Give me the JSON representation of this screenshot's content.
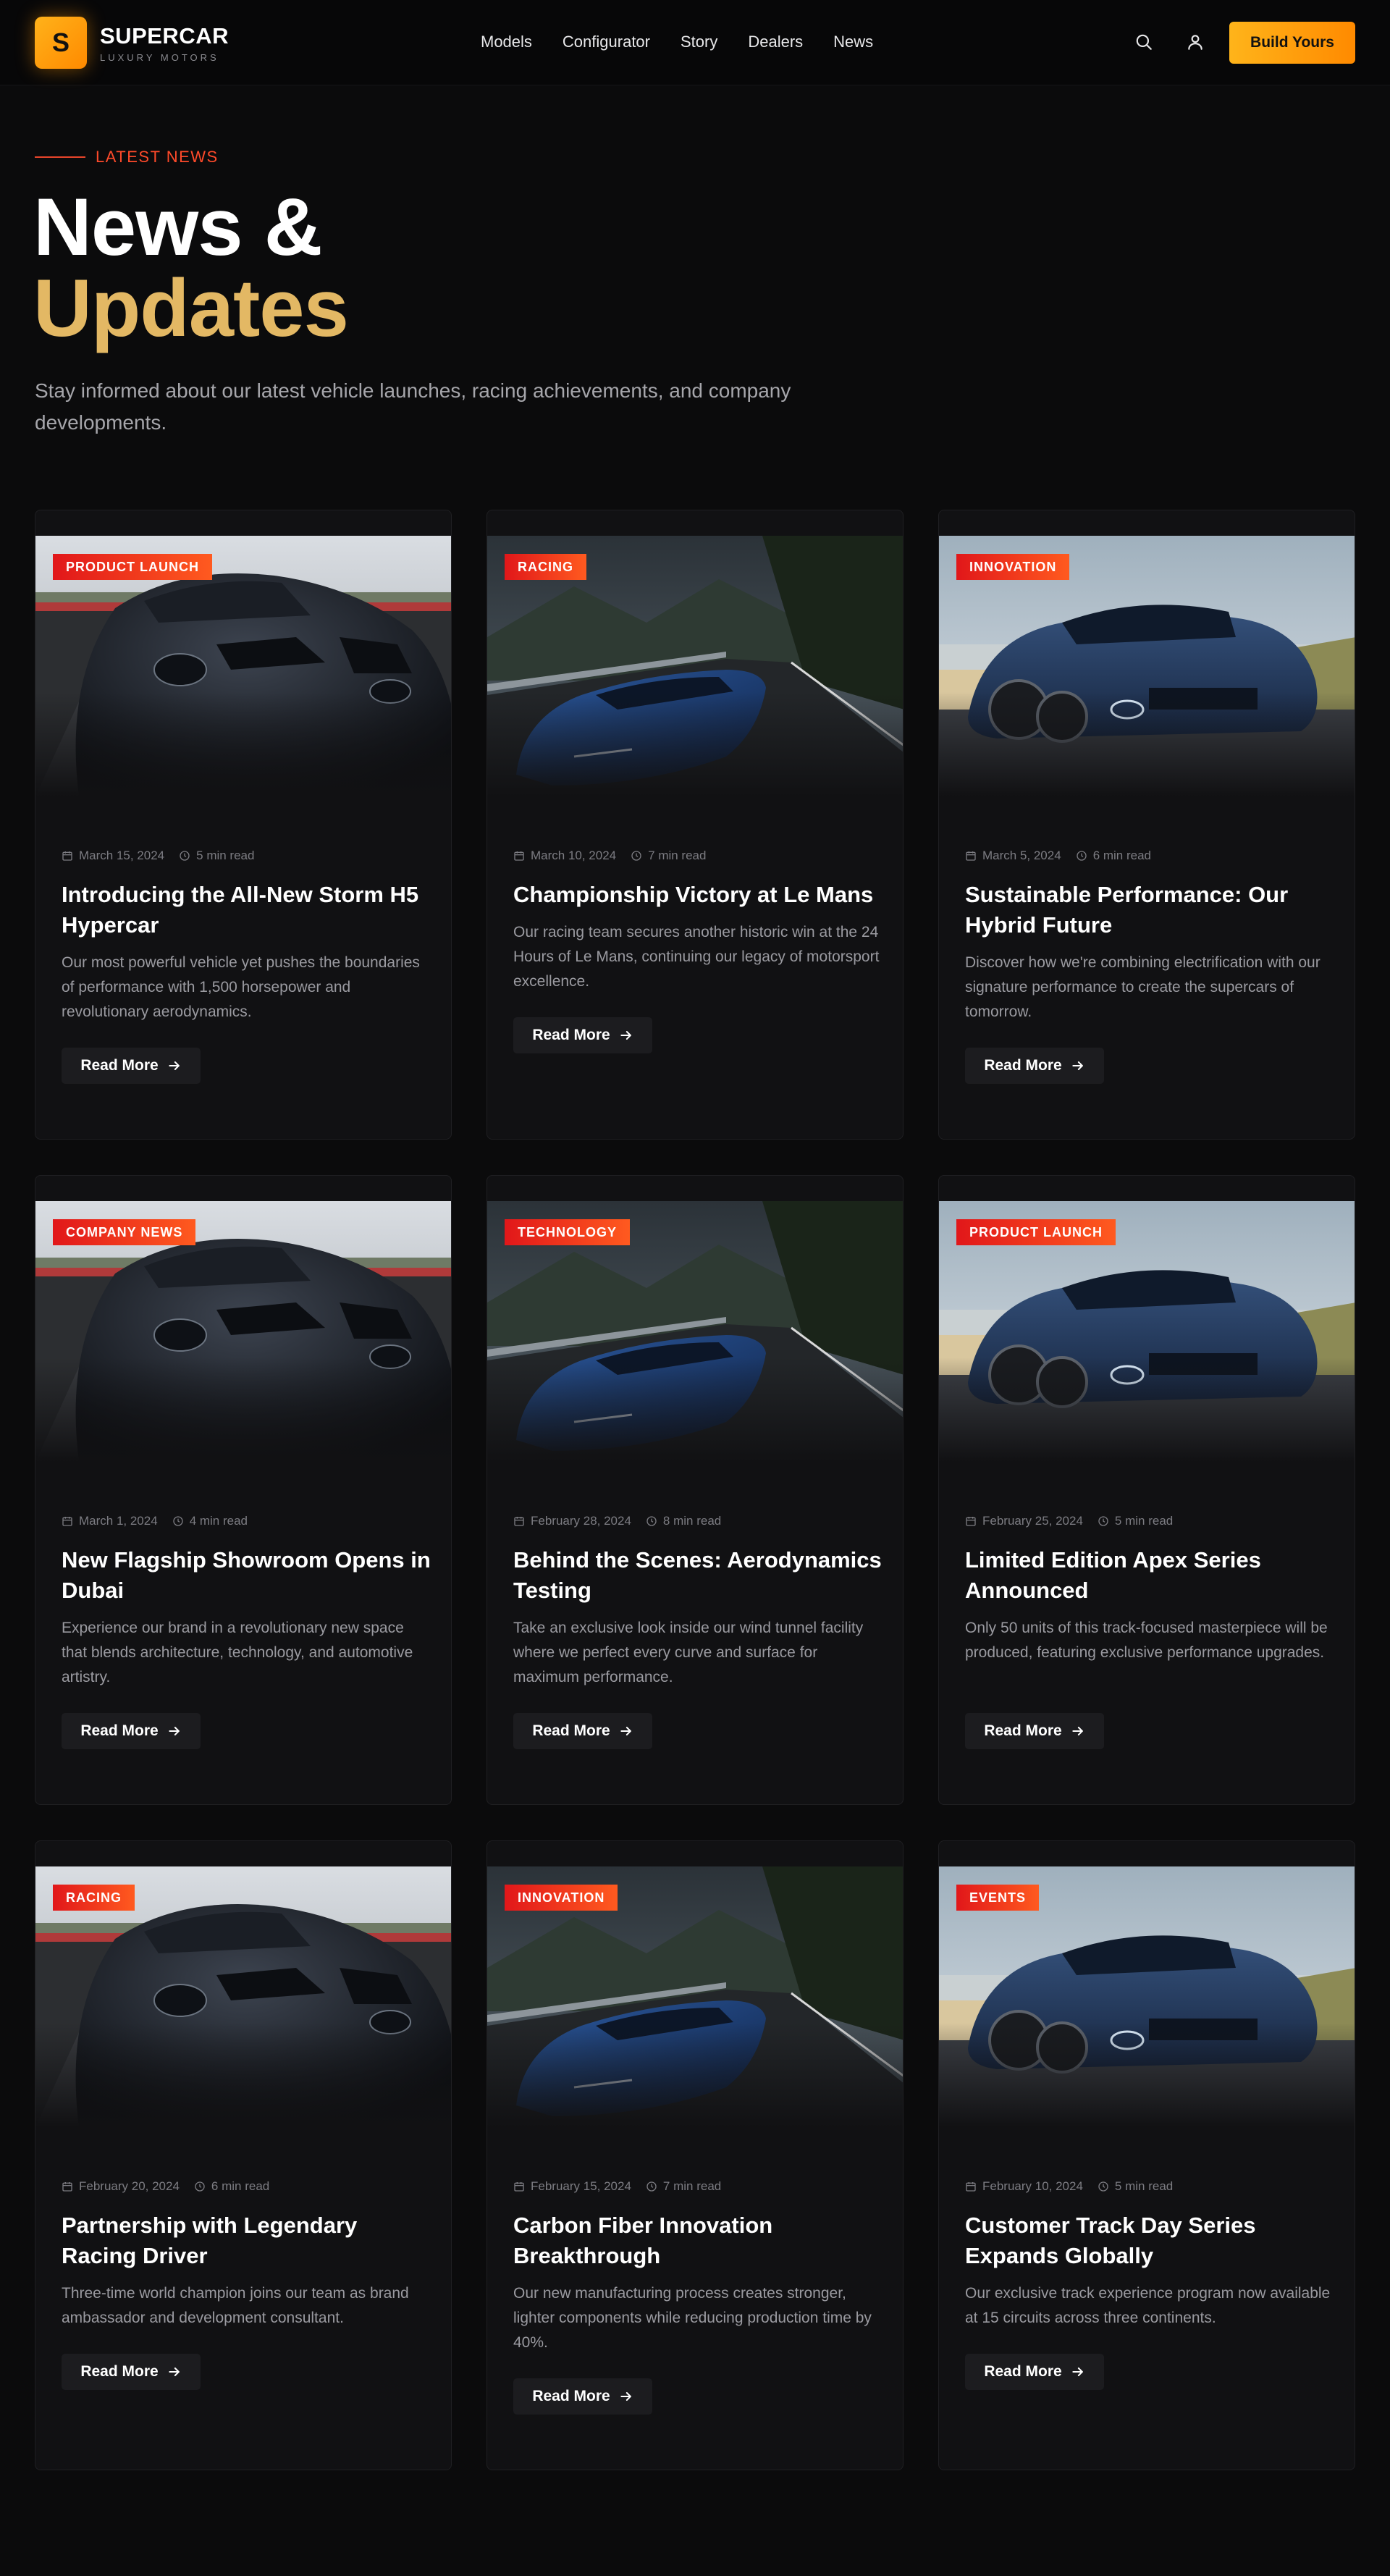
{
  "header": {
    "logo_letter": "S",
    "brand_name": "SUPERCAR",
    "brand_sub": "LUXURY MOTORS",
    "nav": [
      "Models",
      "Configurator",
      "Story",
      "Dealers",
      "News"
    ],
    "cta": "Build Yours"
  },
  "hero": {
    "eyebrow": "LATEST NEWS",
    "title_line1": "News &",
    "title_line2": "Updates",
    "subtitle": "Stay informed about our latest vehicle launches, racing achievements, and company developments."
  },
  "colors": {
    "accent_orange": "#ff8a00",
    "accent_gold": "#e3b864",
    "badge_red": "#e1171a",
    "background": "#0b0b0c"
  },
  "articles": [
    {
      "category": "PRODUCT LAUNCH",
      "date": "March 15, 2024",
      "read_time": "5 min read",
      "title": "Introducing the All-New Storm H5 Hypercar",
      "description": "Our most powerful vehicle yet pushes the boundaries of performance with 1,500 horsepower and revolutionary aerodynamics.",
      "read_more": "Read More",
      "image": "black-hypercar"
    },
    {
      "category": "RACING",
      "date": "March 10, 2024",
      "read_time": "7 min read",
      "title": "Championship Victory at Le Mans",
      "description": "Our racing team secures another historic win at the 24 Hours of Le Mans, continuing our legacy of motorsport excellence.",
      "read_more": "Read More",
      "image": "blue-supercar-mountain-road"
    },
    {
      "category": "INNOVATION",
      "date": "March 5, 2024",
      "read_time": "6 min read",
      "title": "Sustainable Performance: Our Hybrid Future",
      "description": "Discover how we're combining electrification with our signature performance to create the supercars of tomorrow.",
      "read_more": "Read More",
      "image": "blue-supercar-beach"
    },
    {
      "category": "COMPANY NEWS",
      "date": "March 1, 2024",
      "read_time": "4 min read",
      "title": "New Flagship Showroom Opens in Dubai",
      "description": "Experience our brand in a revolutionary new space that blends architecture, technology, and automotive artistry.",
      "read_more": "Read More",
      "image": "black-hypercar"
    },
    {
      "category": "TECHNOLOGY",
      "date": "February 28, 2024",
      "read_time": "8 min read",
      "title": "Behind the Scenes: Aerodynamics Testing",
      "description": "Take an exclusive look inside our wind tunnel facility where we perfect every curve and surface for maximum performance.",
      "read_more": "Read More",
      "image": "blue-supercar-mountain-road"
    },
    {
      "category": "PRODUCT LAUNCH",
      "date": "February 25, 2024",
      "read_time": "5 min read",
      "title": "Limited Edition Apex Series Announced",
      "description": "Only 50 units of this track-focused masterpiece will be produced, featuring exclusive performance upgrades.",
      "read_more": "Read More",
      "image": "blue-supercar-beach"
    },
    {
      "category": "RACING",
      "date": "February 20, 2024",
      "read_time": "6 min read",
      "title": "Partnership with Legendary Racing Driver",
      "description": "Three-time world champion joins our team as brand ambassador and development consultant.",
      "read_more": "Read More",
      "image": "black-hypercar"
    },
    {
      "category": "INNOVATION",
      "date": "February 15, 2024",
      "read_time": "7 min read",
      "title": "Carbon Fiber Innovation Breakthrough",
      "description": "Our new manufacturing process creates stronger, lighter components while reducing production time by 40%.",
      "read_more": "Read More",
      "image": "blue-supercar-mountain-road"
    },
    {
      "category": "EVENTS",
      "date": "February 10, 2024",
      "read_time": "5 min read",
      "title": "Customer Track Day Series Expands Globally",
      "description": "Our exclusive track experience program now available at 15 circuits across three continents.",
      "read_more": "Read More",
      "image": "blue-supercar-beach"
    }
  ]
}
